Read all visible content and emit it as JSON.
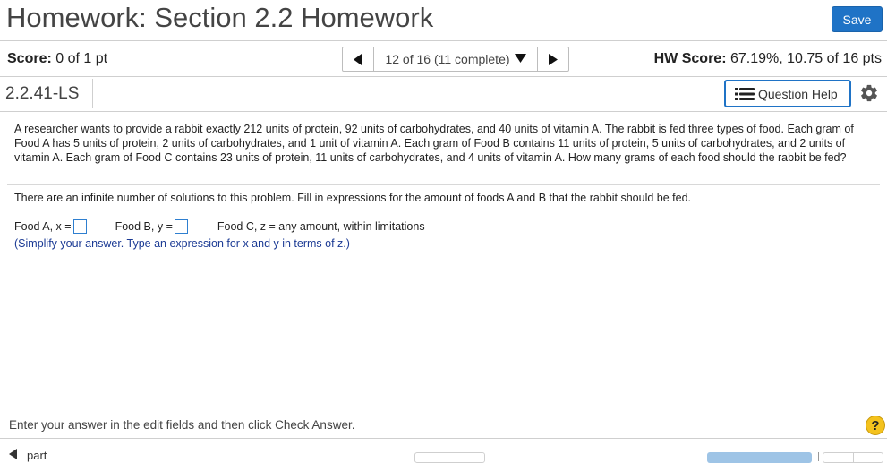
{
  "header": {
    "title": "Homework: Section 2.2 Homework",
    "save_label": "Save"
  },
  "status": {
    "score_label": "Score:",
    "score_value": "0 of 1 pt",
    "nav_position": "12 of 16 (11 complete)",
    "hw_score_label": "HW Score:",
    "hw_score_value": "67.19%, 10.75 of 16 pts"
  },
  "question": {
    "id": "2.2.41-LS",
    "help_label": "Question Help",
    "problem_text": "A researcher wants to provide a rabbit exactly 212 units of protein, 92 units of carbohydrates, and 40 units of vitamin A.  The rabbit is fed three types of food.  Each gram of Food A has 5 units of protein, 2 units of carbohydrates, and 1 unit of vitamin A.  Each gram of Food B contains 11 units of protein, 5 units of carbohydrates, and 2 units of vitamin A.  Each gram of Food C contains 23 units of protein, 11 units of carbohydrates, and 4 units of vitamin A.  How many grams of each food should the rabbit be fed?",
    "instruction": "There are an infinite number of solutions to this problem.  Fill in expressions for the amount of foods A and B that the rabbit should be fed.",
    "food_a_label": "Food A, x =",
    "food_a_value": "",
    "food_b_label": "Food B, y =",
    "food_b_value": "",
    "food_c_label": "Food C, z = any amount, within limitations",
    "hint": "(Simplify your answer. Type an expression for x and y in terms of z.)"
  },
  "footer": {
    "message": "Enter your answer in the edit fields and then click Check Answer.",
    "help_icon_text": "?",
    "part_label": "part"
  },
  "colors": {
    "accent": "#1f73c6",
    "hint_text": "#1b3a94",
    "help_icon": "#f4c21d"
  }
}
